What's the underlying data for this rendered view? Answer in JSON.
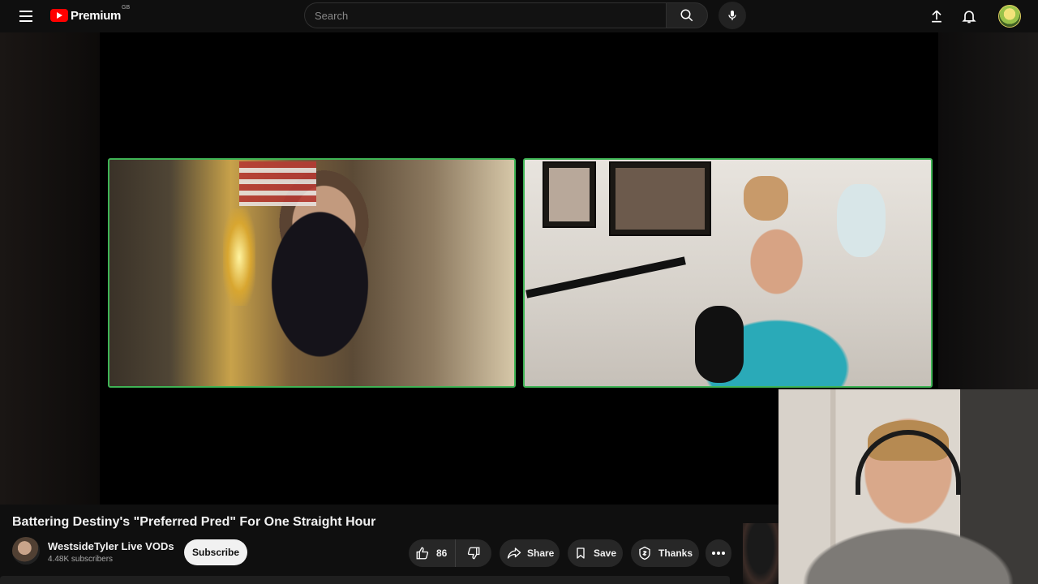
{
  "header": {
    "logo_text": "Premium",
    "region": "GB",
    "search_placeholder": "Search"
  },
  "video": {
    "title": "Battering Destiny's \"Preferred Pred\" For One Straight Hour"
  },
  "channel": {
    "name": "WestsideTyler Live VODs",
    "subscribers": "4.48K subscribers",
    "subscribe_label": "Subscribe"
  },
  "actions": {
    "likes": "86",
    "share_label": "Share",
    "save_label": "Save",
    "thanks_label": "Thanks"
  },
  "icons": [
    "menu-icon",
    "youtube-logo-icon",
    "search-icon",
    "mic-icon",
    "upload-icon",
    "bell-icon",
    "avatar",
    "thumbs-up-icon",
    "thumbs-down-icon",
    "share-icon",
    "bookmark-icon",
    "thanks-icon",
    "more-icon"
  ],
  "colors": {
    "brand_red": "#ff0000",
    "cam_border": "#3fb455",
    "background": "#0f0f0f"
  }
}
